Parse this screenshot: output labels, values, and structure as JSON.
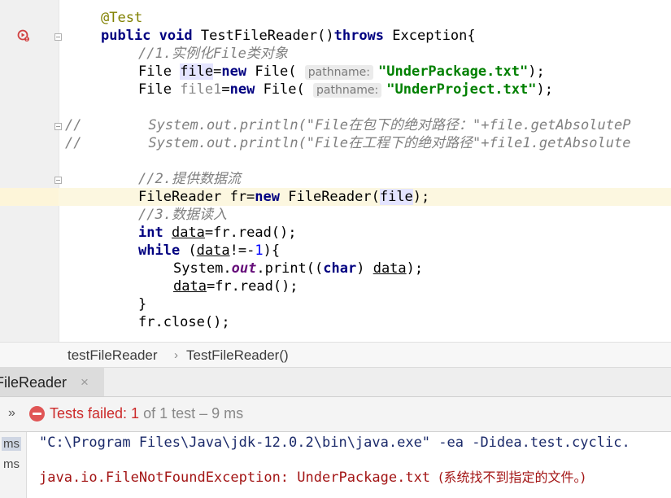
{
  "editor": {
    "lines": {
      "l1": {
        "a": "@Test"
      },
      "l2": {
        "k1": "public",
        "k2": "void",
        "name": " TestFileReader()",
        "k3": "throws",
        "rest": " Exception{"
      },
      "l3": {
        "comment": "//1.实例化File类对象"
      },
      "l4": {
        "t": "File ",
        "v": "file",
        "eq": "=",
        "k": "new",
        "c": " File( ",
        "hint": "pathname:",
        "s": "\"UnderPackage.txt\"",
        "end": ");"
      },
      "l5": {
        "t": "File ",
        "v": "file1",
        "eq": "=",
        "k": "new",
        "c": " File( ",
        "hint": "pathname:",
        "s": "\"UnderProject.txt\"",
        "end": ");"
      },
      "l6": {
        "comment": "//        System.out.println(\"File在包下的绝对路径：\"+file.getAbsoluteP"
      },
      "l7": {
        "comment": "//        System.out.println(\"File在工程下的绝对路径\"+file1.getAbsolute"
      },
      "l8": {
        "comment": "//2.提供数据流"
      },
      "l9": {
        "t": "FileReader fr=",
        "k": "new",
        "c": " FileReader(",
        "v": "file",
        "end": ");"
      },
      "l10": {
        "comment": "//3.数据读入"
      },
      "l11": {
        "k": "int",
        "sp": " ",
        "v": "data",
        "rest": "=fr.read();"
      },
      "l12": {
        "k": "while",
        "a": " (",
        "v": "data",
        "b": "!=-",
        "n": "1",
        "c": "){"
      },
      "l13": {
        "a": "System.",
        "st": "out",
        "b": ".print((",
        "k": "char",
        "c": ") ",
        "v": "data",
        "d": ");"
      },
      "l14": {
        "v": "data",
        "rest": "=fr.read();"
      },
      "l15": {
        "t": "}"
      },
      "l16": {
        "t": "fr.close();"
      }
    }
  },
  "breadcrumb": {
    "items": [
      "testFileReader",
      "TestFileReader()"
    ],
    "separator": "›"
  },
  "run_window": {
    "tab_label": "FileReader",
    "close_glyph": "×",
    "expand_glyph": "»",
    "status_fail": "Tests failed: 1",
    "status_rest": " of 1 test – 9 ms"
  },
  "console": {
    "gutter_labels": [
      "ms",
      "ms"
    ],
    "command": "\"C:\\Program Files\\Java\\jdk-12.0.2\\bin\\java.exe\" -ea -Didea.test.cyclic.",
    "error_main": "java.io.FileNotFoundException: UnderPackage.txt ",
    "error_cn": "(系统找不到指定的文件。)"
  },
  "colors": {
    "keyword": "#000080",
    "string": "#008000",
    "comment": "#808080",
    "annotation": "#808000",
    "error": "#cc2a2a"
  },
  "icons": [
    "run-test-icon",
    "fold-icon",
    "close-icon",
    "expand-icon",
    "test-failed-icon"
  ]
}
